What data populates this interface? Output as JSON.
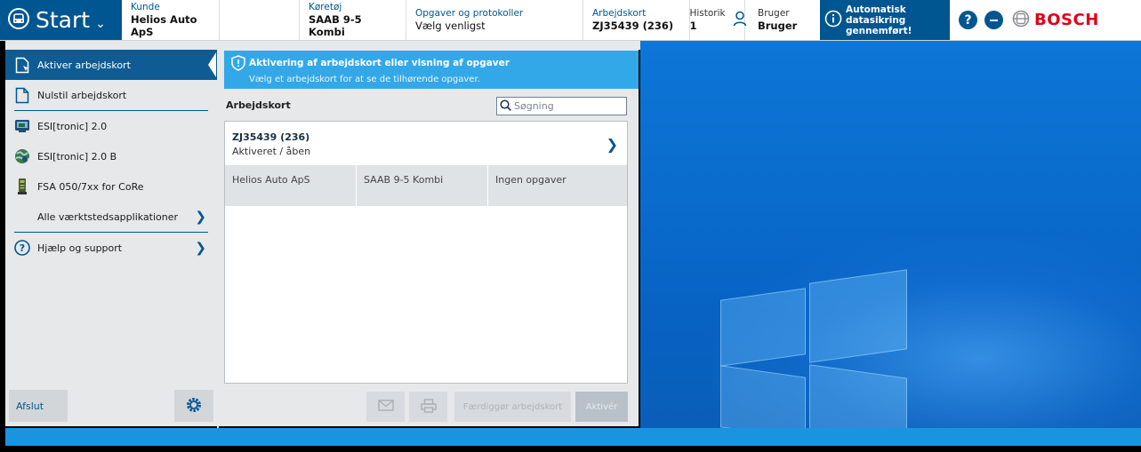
{
  "header": {
    "start_label": "Start",
    "kunde": {
      "label": "Kunde",
      "value": "Helios Auto ApS"
    },
    "koretoj": {
      "label": "Køretøj",
      "value": "SAAB 9-5 Kombi"
    },
    "opgaver": {
      "label": "Opgaver og protokoller",
      "value": "Vælg venligst"
    },
    "arbejdskort": {
      "label": "Arbejdskort",
      "value": "ZJ35439 (236)"
    },
    "historik": {
      "label": "Historik",
      "value": "1"
    },
    "bruger": {
      "label": "Bruger",
      "value": "Bruger"
    },
    "autosave": {
      "line1": "Automatisk datasikring",
      "line2": "gennemført!"
    },
    "help_symbol": "?",
    "brand": "BOSCH"
  },
  "sidebar": {
    "items": [
      {
        "label": "Aktiver arbejdskort",
        "icon": "document-activate-icon",
        "active": true
      },
      {
        "label": "Nulstil arbejdskort",
        "icon": "document-icon",
        "active": false
      },
      {
        "label": "ESI[tronic] 2.0",
        "icon": "esitronic-icon",
        "active": false
      },
      {
        "label": "ESI[tronic] 2.0 B",
        "icon": "globe-icon",
        "active": false
      },
      {
        "label": "FSA 050/7xx for CoRe",
        "icon": "fsa-device-icon",
        "active": false
      },
      {
        "label": "Alle værktstedsapplikationer",
        "icon": "",
        "active": false
      },
      {
        "label": "Hjælp og support",
        "icon": "help-circle-icon",
        "active": false
      }
    ],
    "exit_label": "Afslut",
    "settings_icon": "gear-icon"
  },
  "main": {
    "banner_title": "Aktivering af arbejdskort eller visning af opgaver",
    "banner_sub": "Vælg et arbejdskort for at se de tilhørende opgaver.",
    "section_label": "Arbejdskort",
    "search_placeholder": "Søgning",
    "card": {
      "code": "ZJ35439 (236)",
      "status": "Aktiveret / åben",
      "customer": "Helios Auto ApS",
      "vehicle": "SAAB 9-5 Kombi",
      "tasks": "Ingen opgaver"
    },
    "actions": {
      "mail_icon": "mail-icon",
      "print_icon": "print-icon",
      "finish_label": "Færdiggør arbejdskort",
      "activate_label": "Aktivér"
    }
  },
  "colors": {
    "primary": "#005691",
    "banner": "#33a8e8",
    "brand_red": "#e20015",
    "desktop": "#0a6ccd"
  }
}
